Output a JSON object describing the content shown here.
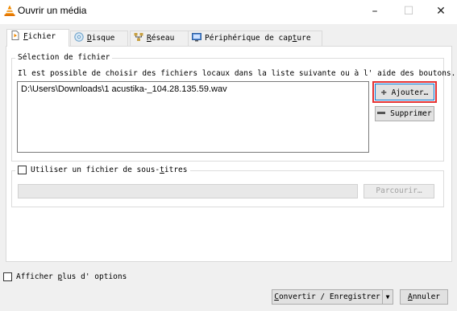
{
  "window": {
    "title": "Ouvrir un média",
    "minimize": "–",
    "maximize": "☐",
    "close": "✕"
  },
  "tabs": [
    {
      "label": "Fichier",
      "accel": "F",
      "rest": "ichier",
      "icon": "file-icon"
    },
    {
      "label": "Disque",
      "accel": "D",
      "rest": "isque",
      "icon": "disc-icon"
    },
    {
      "label": "Réseau",
      "accel": "R",
      "rest": "éseau",
      "icon": "network-icon"
    },
    {
      "label": "Périphérique de capture",
      "pre": "Périphérique de cap",
      "accel": "t",
      "rest": "ure",
      "icon": "capture-device-icon"
    }
  ],
  "file_section": {
    "legend": "Sélection de fichier",
    "description": "Il est possible de choisir des fichiers locaux dans la liste suivante ou à l' aide des boutons.",
    "files": [
      "D:\\Users\\Downloads\\1 acustika-_104.28.135.59.wav"
    ],
    "add_label": "Ajouter…",
    "remove_label": "Supprimer"
  },
  "subtitle_section": {
    "checkbox_pre": "Utiliser un fichier de sous-",
    "checkbox_accel": "t",
    "checkbox_rest": "itres",
    "path_value": "",
    "browse_label": "Parcourir…"
  },
  "options": {
    "pre": "Afficher ",
    "accel": "p",
    "rest": "lus d' options"
  },
  "footer": {
    "convert_accel": "C",
    "convert_rest": "onvertir / Enregistrer",
    "dropdown_arrow": "▼",
    "cancel_accel": "A",
    "cancel_rest": "nnuler"
  },
  "colors": {
    "highlight": "#e53232",
    "vlc_orange": "#f08a00",
    "selected_button_border": "#0078d7"
  }
}
